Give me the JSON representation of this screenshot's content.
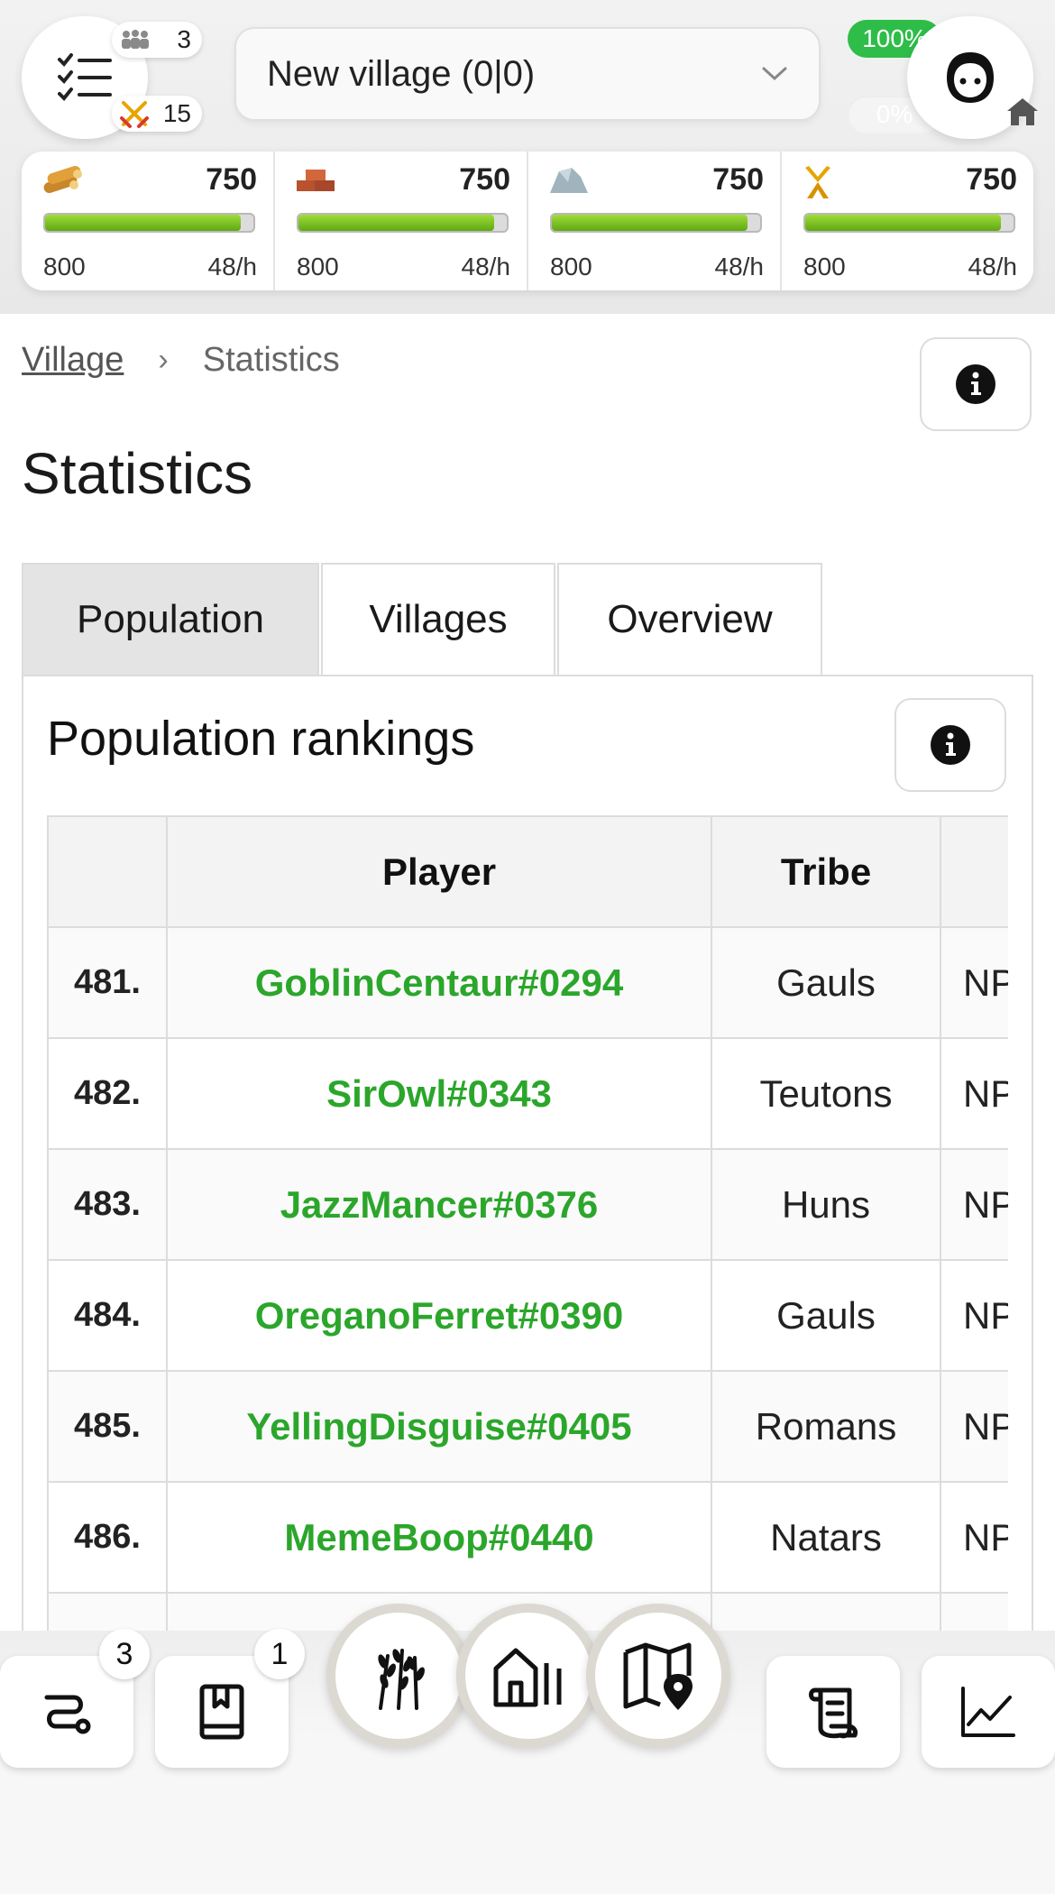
{
  "header": {
    "troop_count": "3",
    "attack_count": "15",
    "village_name": "New village (0|0)",
    "culture_percent": "100%",
    "loyalty_percent": "0%",
    "colors": {
      "culture": "#2ebd48",
      "resource_bar": "#7cc425"
    }
  },
  "resources": [
    {
      "name": "wood",
      "icon": "wood-icon",
      "amount": "750",
      "capacity": "800",
      "production": "48/h",
      "fill": 0.9375
    },
    {
      "name": "clay",
      "icon": "clay-icon",
      "amount": "750",
      "capacity": "800",
      "production": "48/h",
      "fill": 0.9375
    },
    {
      "name": "iron",
      "icon": "iron-icon",
      "amount": "750",
      "capacity": "800",
      "production": "48/h",
      "fill": 0.9375
    },
    {
      "name": "crop",
      "icon": "crop-icon",
      "amount": "750",
      "capacity": "800",
      "production": "48/h",
      "fill": 0.9375
    }
  ],
  "breadcrumb": {
    "parent": "Village",
    "current": "Statistics"
  },
  "page": {
    "title": "Statistics"
  },
  "tabs": [
    {
      "label": "Population",
      "active": true
    },
    {
      "label": "Villages",
      "active": false
    },
    {
      "label": "Overview",
      "active": false
    }
  ],
  "panel": {
    "title": "Population rankings"
  },
  "table": {
    "headers": {
      "rank": "",
      "player": "Player",
      "tribe": "Tribe",
      "alliance": ""
    },
    "rows": [
      {
        "rank": "481.",
        "player": "GoblinCentaur#0294",
        "tribe": "Gauls",
        "alliance": "NPC"
      },
      {
        "rank": "482.",
        "player": "SirOwl#0343",
        "tribe": "Teutons",
        "alliance": "NPC"
      },
      {
        "rank": "483.",
        "player": "JazzMancer#0376",
        "tribe": "Huns",
        "alliance": "NPC"
      },
      {
        "rank": "484.",
        "player": "OreganoFerret#0390",
        "tribe": "Gauls",
        "alliance": "NPC"
      },
      {
        "rank": "485.",
        "player": "YellingDisguise#0405",
        "tribe": "Romans",
        "alliance": "NPC"
      },
      {
        "rank": "486.",
        "player": "MemeBoop#0440",
        "tribe": "Natars",
        "alliance": "NPC"
      },
      {
        "rank": "",
        "player": "",
        "tribe": "",
        "alliance": ""
      }
    ]
  },
  "bottom_nav": {
    "adventures_badge": "3",
    "reports_badge": "1",
    "items": [
      "route-icon",
      "book-icon",
      "wheat-icon",
      "village-buildings-icon",
      "map-icon",
      "scroll-icon",
      "chart-icon"
    ]
  }
}
